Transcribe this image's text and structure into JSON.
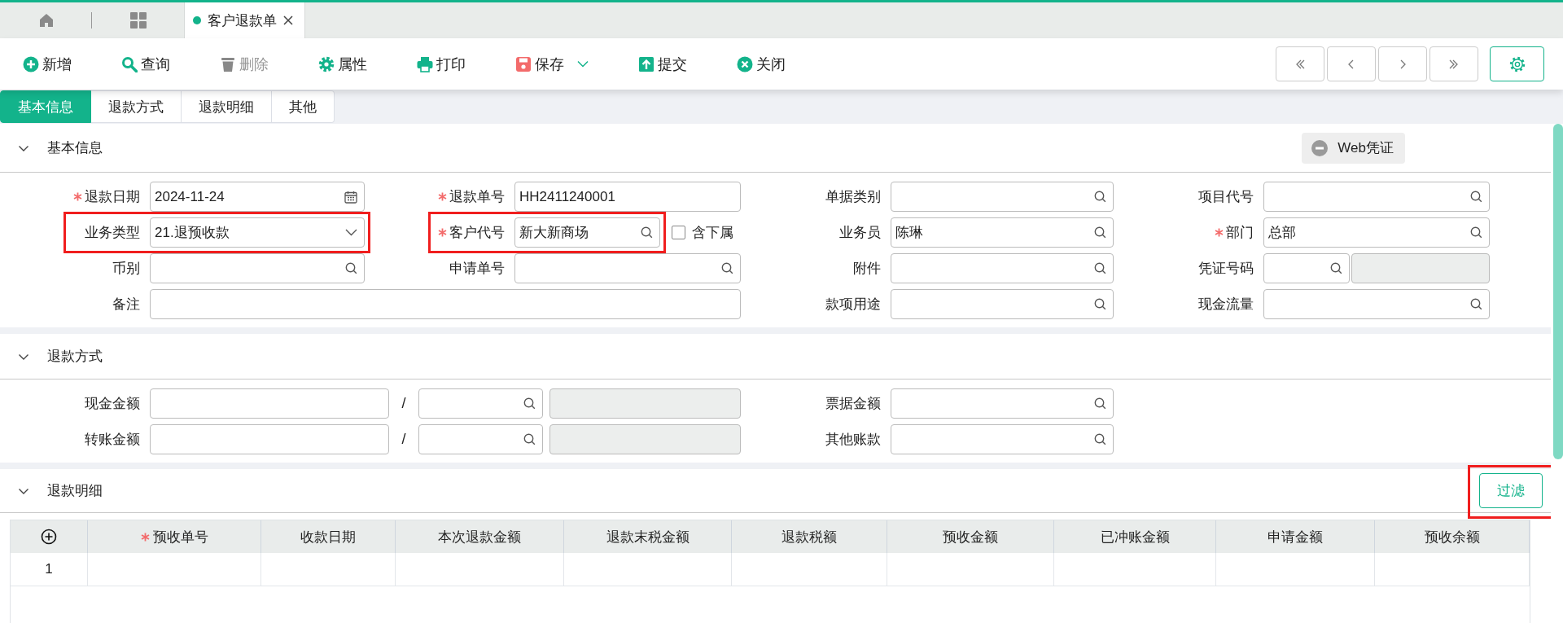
{
  "tabs": [
    {
      "kind": "home",
      "selected": false
    },
    {
      "kind": "grid",
      "selected": false
    },
    {
      "kind": "page",
      "label": "客户退款单",
      "selected": true
    }
  ],
  "toolbar": [
    {
      "kind": "add",
      "label": "新增",
      "disabled": false,
      "dropdown": false
    },
    {
      "kind": "search",
      "label": "查询",
      "disabled": false,
      "dropdown": false
    },
    {
      "kind": "delete",
      "label": "删除",
      "disabled": true,
      "dropdown": false
    },
    {
      "kind": "settings",
      "label": "属性",
      "disabled": false,
      "dropdown": false
    },
    {
      "kind": "print",
      "label": "打印",
      "disabled": false,
      "dropdown": false
    },
    {
      "kind": "save",
      "label": "保存",
      "disabled": false,
      "dropdown": true
    },
    {
      "kind": "submit",
      "label": "提交",
      "disabled": false,
      "dropdown": false
    },
    {
      "kind": "close",
      "label": "关闭",
      "disabled": false,
      "dropdown": false
    }
  ],
  "nav_buttons": [
    {
      "kind": "first"
    },
    {
      "kind": "prev"
    },
    {
      "kind": "next"
    },
    {
      "kind": "last"
    }
  ],
  "form_tabs": [
    {
      "label": "基本信息",
      "selected": true
    },
    {
      "label": "退款方式",
      "selected": false
    },
    {
      "label": "退款明细",
      "selected": false
    },
    {
      "label": "其他",
      "selected": false
    }
  ],
  "sections": [
    {
      "kind": "form",
      "title": "基本信息",
      "expanded": true,
      "action": {
        "label": "Web凭证"
      },
      "rows": [
        [
          {
            "label": "退款日期",
            "required": true,
            "kind": "date",
            "value": "2024-11-24",
            "highlighted": false
          },
          {
            "label": "退款单号",
            "required": true,
            "kind": "text",
            "value": "HH2411240001",
            "highlighted": false
          },
          {
            "label": "单据类别",
            "required": false,
            "kind": "lookup",
            "highlighted": false
          },
          {
            "label": "项目代号",
            "required": false,
            "kind": "lookup",
            "highlighted": false
          }
        ],
        [
          {
            "label": "业务类型",
            "required": false,
            "kind": "select",
            "value": "21.退预收款",
            "highlighted": true
          },
          {
            "label": "客户代号",
            "required": true,
            "kind": "lookup",
            "value": "新大新商场",
            "highlighted": true,
            "checkbox": {
              "label": "含下属",
              "checked": false
            }
          },
          {
            "label": "业务员",
            "required": false,
            "kind": "lookup",
            "value": "陈琳",
            "highlighted": false
          },
          {
            "label": "部门",
            "required": true,
            "kind": "lookup",
            "value": "总部",
            "highlighted": false
          }
        ],
        [
          {
            "label": "币别",
            "required": false,
            "kind": "lookup",
            "highlighted": false
          },
          {
            "label": "申请单号",
            "required": false,
            "kind": "lookup",
            "highlighted": false
          },
          {
            "label": "附件",
            "required": false,
            "kind": "lookup",
            "highlighted": false
          },
          {
            "label": "凭证号码",
            "required": false,
            "kind": "voucher",
            "highlighted": false
          }
        ],
        [
          {
            "label": "备注",
            "required": false,
            "kind": "wide",
            "highlighted": false
          },
          "",
          {
            "label": "款项用途",
            "required": false,
            "kind": "lookup",
            "highlighted": false
          },
          {
            "label": "现金流量",
            "required": false,
            "kind": "lookup",
            "highlighted": false
          }
        ]
      ]
    },
    {
      "kind": "form",
      "title": "退款方式",
      "expanded": true,
      "rows": [
        [
          {
            "label": "现金金额",
            "required": false,
            "kind": "amount",
            "separator": "/",
            "highlighted": false
          },
          "",
          {
            "label": "票据金额",
            "required": false,
            "kind": "lookup",
            "highlighted": false
          }
        ],
        [
          {
            "label": "转账金额",
            "required": false,
            "kind": "amount",
            "separator": "/",
            "highlighted": false
          },
          "",
          {
            "label": "其他账款",
            "required": false,
            "kind": "lookup",
            "highlighted": false
          }
        ]
      ]
    },
    {
      "kind": "table",
      "title": "退款明细",
      "expanded": true,
      "filter_button": {
        "label": "过滤",
        "highlighted": true
      },
      "columns": [
        {
          "label": "预收单号",
          "required": true
        },
        {
          "label": "收款日期",
          "required": false
        },
        {
          "label": "本次退款金额",
          "required": false
        },
        {
          "label": "退款末税金额",
          "required": false
        },
        {
          "label": "退款税额",
          "required": false
        },
        {
          "label": "预收金额",
          "required": false
        },
        {
          "label": "已冲账金额",
          "required": false
        },
        {
          "label": "申请金额",
          "required": false
        },
        {
          "label": "预收余额",
          "required": false
        }
      ],
      "rows": [
        {
          "index": "1"
        }
      ]
    }
  ]
}
